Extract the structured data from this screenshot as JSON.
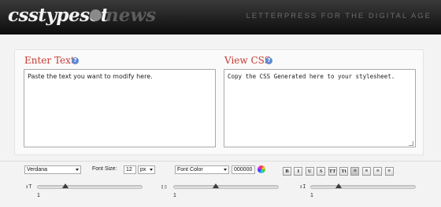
{
  "header": {
    "logo_main": "csstypeset",
    "logo_news": "news",
    "tagline": "LETTERPRESS FOR THE DIGITAL AGE"
  },
  "editor": {
    "enter_title": "Enter Text",
    "enter_placeholder": "Paste the text you want to modify here.",
    "view_title": "View CSS",
    "view_placeholder": "Copy the CSS Generated here to your stylesheet.",
    "help_glyph": "?"
  },
  "toolbar": {
    "font_family": "Verdana",
    "font_size_label": "Font Size:",
    "font_size_value": "12",
    "font_size_unit": "px",
    "font_color_label": "Font Color",
    "font_color_value": "000000",
    "buttons": [
      {
        "label": "B",
        "name": "bold-button"
      },
      {
        "label": "I",
        "name": "italic-button"
      },
      {
        "label": "U",
        "name": "underline-button"
      },
      {
        "label": "S",
        "name": "strikethrough-button"
      },
      {
        "label": "TT",
        "name": "uppercase-button"
      },
      {
        "label": "Tt",
        "name": "capitalize-button"
      },
      {
        "label": "≡",
        "name": "align-left-button"
      },
      {
        "label": "≡",
        "name": "align-center-button"
      },
      {
        "label": "≡",
        "name": "align-right-button"
      },
      {
        "label": "≡",
        "name": "align-justify-button"
      }
    ]
  },
  "sliders": [
    {
      "name": "letter-spacing-slider",
      "value": "1",
      "level": 0.27
    },
    {
      "name": "word-spacing-slider",
      "value": "1",
      "level": 0.4
    },
    {
      "name": "line-height-slider",
      "value": "1",
      "level": 0.27
    }
  ]
}
